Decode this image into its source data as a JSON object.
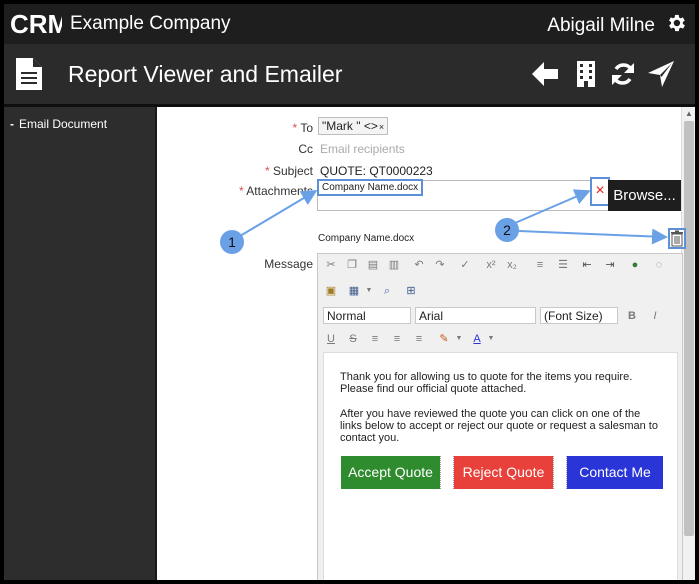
{
  "header": {
    "logo_text": "CRM",
    "company": "Example Company",
    "user": "Abigail Milne",
    "icons": [
      "gear-icon"
    ]
  },
  "titlebar": {
    "title": "Report Viewer and Emailer",
    "icons": [
      "document-icon",
      "back-arrow-icon",
      "building-icon",
      "refresh-icon",
      "send-icon"
    ]
  },
  "sidebar": {
    "items": [
      {
        "label": "Email Document"
      }
    ]
  },
  "form": {
    "to": {
      "required_mark": "*",
      "label": "To",
      "recipient": "\"Mark \" <>",
      "remove_glyph": "×"
    },
    "cc": {
      "label": "Cc",
      "placeholder": "Email recipients"
    },
    "subject": {
      "required_mark": "*",
      "label": "Subject",
      "value": "QUOTE: QT0000223"
    },
    "attachments": {
      "required_mark": "*",
      "label": "Attachments",
      "file": "Company Name.docx",
      "remove_glyph": "×",
      "browse_label": "Browse...",
      "listed_file": "Company Name.docx"
    },
    "message": {
      "label": "Message"
    }
  },
  "editor": {
    "format_value": "Normal",
    "font_value": "Arial",
    "size_value": "(Font Size)",
    "paragraphs": [
      "Thank you for allowing us to quote for the items you require. Please find our official quote attached.",
      "After you have reviewed the quote you can click on one of the links below to accept or reject our quote or request a salesman to contact you."
    ],
    "buttons": [
      {
        "label": "Accept Quote",
        "color": "#2e8b2e"
      },
      {
        "label": "Reject Quote",
        "color": "#e8403a"
      },
      {
        "label": "Contact Me",
        "color": "#2a35d8"
      }
    ]
  },
  "callouts": [
    "1",
    "2"
  ],
  "colors": {
    "topbar": "#1e1e1e",
    "titlebar": "#2b2b2b",
    "sidebar": "#2d2d2d",
    "callout": "#6aa0e6",
    "required": "#d9534f"
  }
}
